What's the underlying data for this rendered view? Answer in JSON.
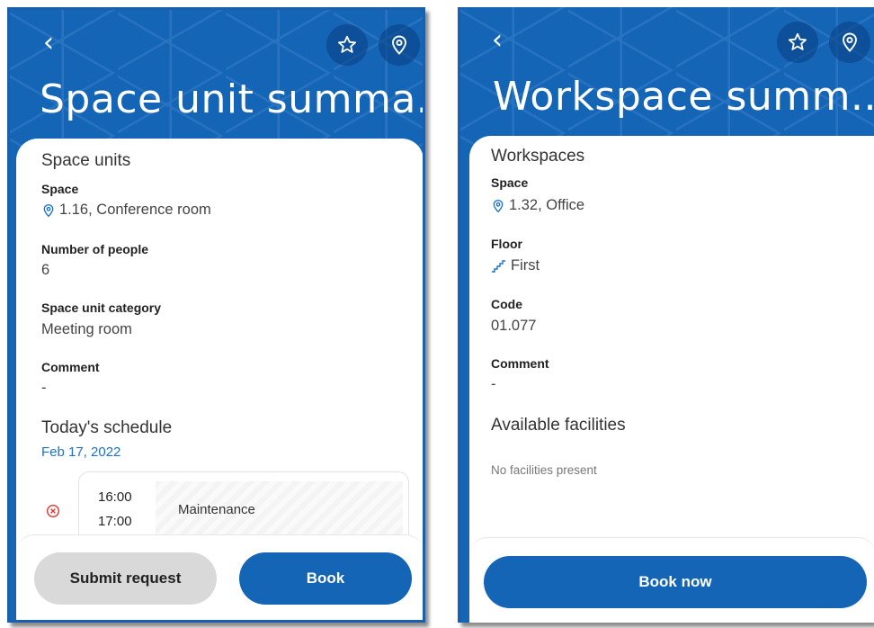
{
  "left": {
    "title": "Space unit summa...",
    "section_title": "Space units",
    "fields": [
      {
        "label": "Space",
        "value": "1.16, Conference room",
        "icon": "location-pin-icon"
      },
      {
        "label": "Number of people",
        "value": "6"
      },
      {
        "label": "Space unit category",
        "value": "Meeting room"
      },
      {
        "label": "Comment",
        "value": "-"
      }
    ],
    "schedule": {
      "title": "Today's schedule",
      "date": "Feb 17, 2022",
      "items": [
        {
          "start": "16:00",
          "end": "17:00",
          "name": "Maintenance",
          "status_icon": "cancel-circle-icon"
        }
      ]
    },
    "buttons": {
      "submit": "Submit request",
      "book": "Book"
    }
  },
  "right": {
    "title": "Workspace summ...",
    "section_title": "Workspaces",
    "fields": [
      {
        "label": "Space",
        "value": "1.32, Office",
        "icon": "location-pin-icon"
      },
      {
        "label": "Floor",
        "value": "First",
        "icon": "stairs-icon"
      },
      {
        "label": "Code",
        "value": "01.077"
      },
      {
        "label": "Comment",
        "value": "-"
      }
    ],
    "facilities": {
      "title": "Available facilities",
      "empty_text": "No facilities present"
    },
    "buttons": {
      "book_now": "Book now"
    }
  },
  "colors": {
    "brand": "#1565b7",
    "link": "#1a73c9",
    "danger": "#e0332b",
    "neutral_button": "#d9d9d9"
  }
}
